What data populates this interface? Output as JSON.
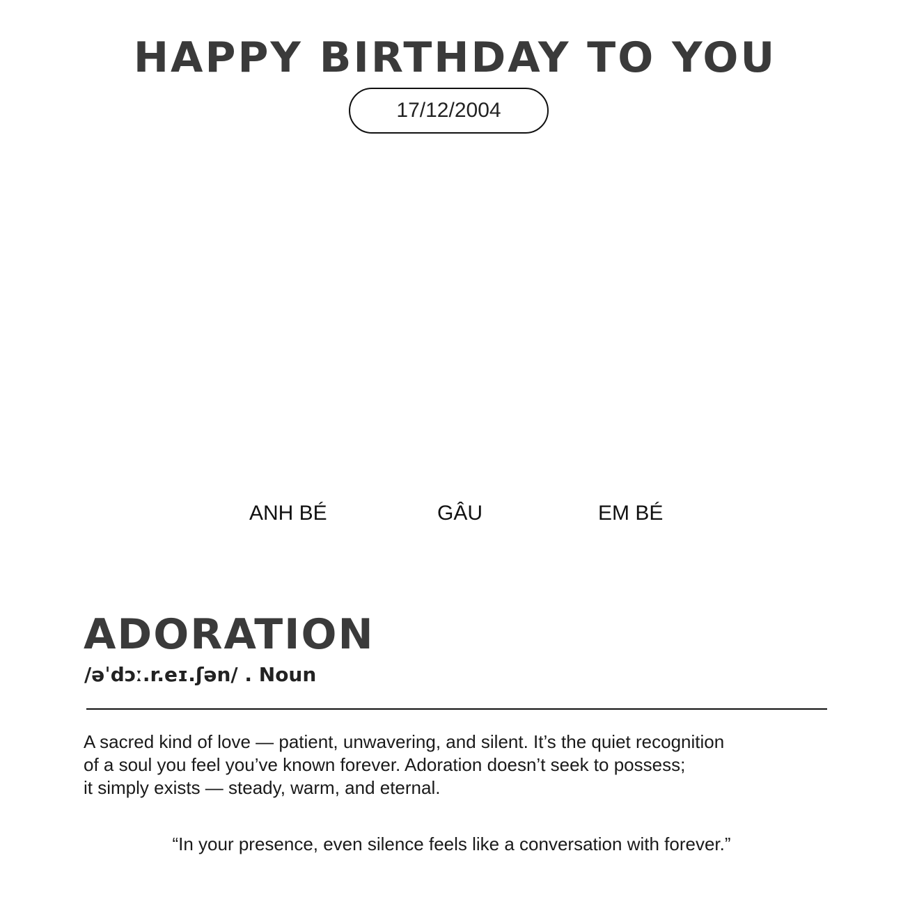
{
  "header": {
    "title": "HAPPY BIRTHDAY TO YOU",
    "date": "17/12/2004"
  },
  "names": [
    "ANH BÉ",
    "GÂU",
    "EM BÉ"
  ],
  "entry": {
    "word": "ADORATION",
    "pronunciation": "/əˈdɔː.r.eɪ.ʃən/ . Noun",
    "definition_lines": [
      "A sacred kind of love — patient, unwavering, and silent. It’s the quiet recognition",
      "of a soul you feel you’ve known forever. Adoration doesn’t seek to possess;",
      "it simply exists — steady, warm, and eternal."
    ],
    "quote": "“In your presence, even silence feels like a conversation with forever.”"
  },
  "colors": {
    "background": "#ffffff",
    "heading": "#3a3a3a",
    "text": "#1a1a1a",
    "rule": "#111111"
  }
}
